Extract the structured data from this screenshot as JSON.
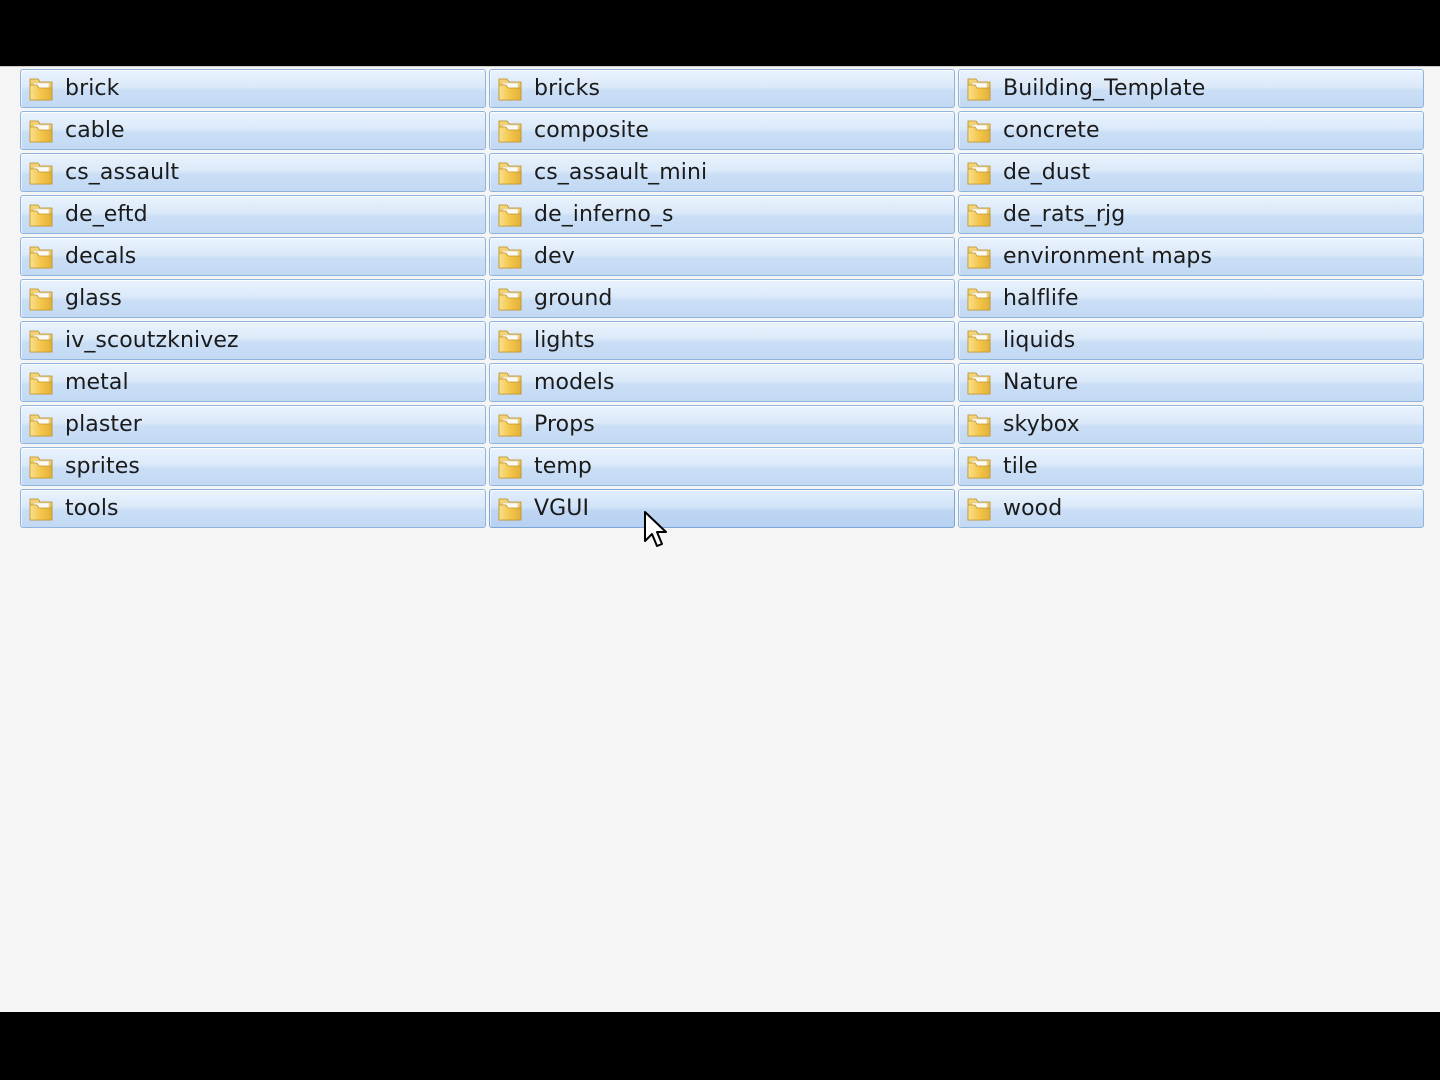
{
  "folders": [
    {
      "name": "brick"
    },
    {
      "name": "bricks"
    },
    {
      "name": "Building_Template"
    },
    {
      "name": "cable"
    },
    {
      "name": "composite"
    },
    {
      "name": "concrete"
    },
    {
      "name": "cs_assault"
    },
    {
      "name": "cs_assault_mini"
    },
    {
      "name": "de_dust"
    },
    {
      "name": "de_eftd"
    },
    {
      "name": "de_inferno_s"
    },
    {
      "name": "de_rats_rjg"
    },
    {
      "name": "decals"
    },
    {
      "name": "dev"
    },
    {
      "name": "environment maps"
    },
    {
      "name": "glass"
    },
    {
      "name": "ground"
    },
    {
      "name": "halflife"
    },
    {
      "name": "iv_scoutzknivez"
    },
    {
      "name": "lights"
    },
    {
      "name": "liquids"
    },
    {
      "name": "metal"
    },
    {
      "name": "models"
    },
    {
      "name": "Nature"
    },
    {
      "name": "plaster"
    },
    {
      "name": "Props"
    },
    {
      "name": "skybox"
    },
    {
      "name": "sprites"
    },
    {
      "name": "temp"
    },
    {
      "name": "tile"
    },
    {
      "name": "tools"
    },
    {
      "name": "VGUI"
    },
    {
      "name": "wood"
    }
  ],
  "hovered_folder": "VGUI",
  "icons": {
    "folder": "folder-icon",
    "cursor": "mouse-pointer-icon"
  },
  "colors": {
    "selection_fill": "#cadff6",
    "selection_border": "#8fb4de",
    "pane_background": "#f5f5f5",
    "folder_yellow": "#f3c64a"
  }
}
